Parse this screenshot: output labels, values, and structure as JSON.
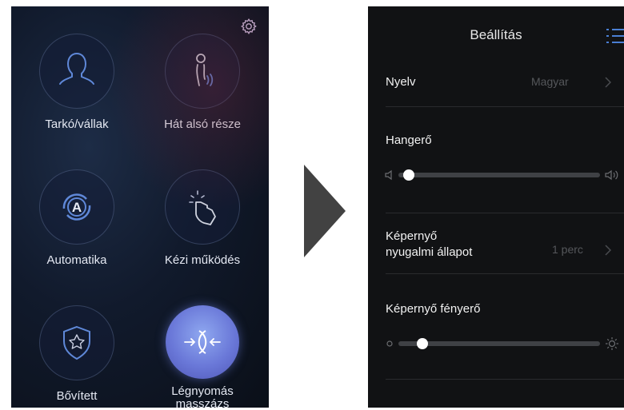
{
  "left": {
    "settings_icon": "gear-icon",
    "modes": [
      {
        "label": "Tarkó/vállak",
        "icon": "neck-shoulders-icon",
        "active": false
      },
      {
        "label": "Hát alsó része",
        "icon": "lower-back-icon",
        "active": false
      },
      {
        "label": "Automatika",
        "icon": "auto-icon",
        "active": false
      },
      {
        "label": "Kézi működés",
        "icon": "manual-hand-icon",
        "active": false
      },
      {
        "label": "Bővített",
        "icon": "shield-star-icon",
        "active": false
      },
      {
        "label": "Légnyomás masszázs",
        "icon": "air-pressure-icon",
        "active": true
      }
    ]
  },
  "right": {
    "title": "Beállítás",
    "menu_icon": "menu-list-icon",
    "language": {
      "label": "Nyelv",
      "value": "Magyar"
    },
    "volume": {
      "label": "Hangerő",
      "level": 0.05
    },
    "screen_sleep": {
      "label_line1": "Képernyő",
      "label_line2": "nyugalmi állapot",
      "value": "1 perc"
    },
    "brightness": {
      "label": "Képernyő fényerő",
      "level": 0.12
    }
  },
  "colors": {
    "accent": "#6a78d8",
    "settings_bg": "#111214"
  }
}
